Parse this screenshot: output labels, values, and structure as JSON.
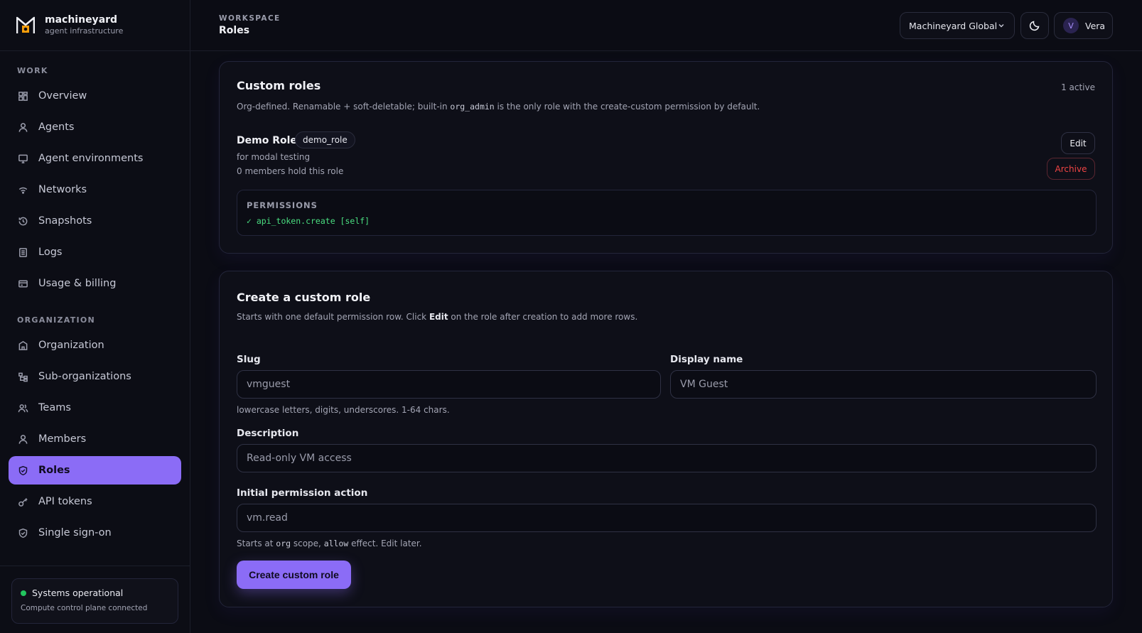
{
  "brand": {
    "name": "machineyard",
    "tagline": "agent infrastructure"
  },
  "sidebar": {
    "work_label": "WORK",
    "org_label": "ORGANIZATION",
    "work_items": [
      {
        "label": "Overview",
        "icon": "grid-icon"
      },
      {
        "label": "Agents",
        "icon": "user-icon"
      },
      {
        "label": "Agent environments",
        "icon": "monitor-icon"
      },
      {
        "label": "Networks",
        "icon": "wifi-icon"
      },
      {
        "label": "Snapshots",
        "icon": "history-icon"
      },
      {
        "label": "Logs",
        "icon": "document-icon"
      },
      {
        "label": "Usage & billing",
        "icon": "card-icon"
      }
    ],
    "org_items": [
      {
        "label": "Organization",
        "icon": "building-icon"
      },
      {
        "label": "Sub-organizations",
        "icon": "tree-icon"
      },
      {
        "label": "Teams",
        "icon": "users-icon"
      },
      {
        "label": "Members",
        "icon": "person-icon"
      },
      {
        "label": "Roles",
        "icon": "shield-icon",
        "active": true
      },
      {
        "label": "API tokens",
        "icon": "key-icon"
      },
      {
        "label": "Single sign-on",
        "icon": "shield-check-icon"
      }
    ],
    "status": {
      "title": "Systems operational",
      "subtitle": "Compute control plane connected",
      "color": "#22c55e"
    }
  },
  "header": {
    "section": "WORKSPACE",
    "title": "Roles",
    "org_select": "Machineyard Global",
    "user": {
      "initial": "V",
      "name": "Vera"
    }
  },
  "custom_roles": {
    "title": "Custom roles",
    "active_count": "1 active",
    "desc_before": "Org-defined. Renamable + soft-deletable; built-in ",
    "desc_code": "org_admin",
    "desc_after": " is the only role with the create-custom permission by default.",
    "role": {
      "name": "Demo Role",
      "slug": "demo_role",
      "description": "for modal testing",
      "members": "0 members hold this role",
      "edit_label": "Edit",
      "archive_label": "Archive",
      "permissions_label": "PERMISSIONS",
      "permissions": [
        "✓ api_token.create [self]"
      ]
    }
  },
  "create_role": {
    "title": "Create a custom role",
    "desc_before": "Starts with one default permission row. Click ",
    "desc_bold": "Edit",
    "desc_after": " on the role after creation to add more rows.",
    "slug_label": "Slug",
    "slug_placeholder": "vmguest",
    "slug_hint": "lowercase letters, digits, underscores. 1-64 chars.",
    "display_label": "Display name",
    "display_placeholder": "VM Guest",
    "description_label": "Description",
    "description_placeholder": "Read-only VM access",
    "action_label": "Initial permission action",
    "action_placeholder": "vm.read",
    "hint_1": "Starts at ",
    "hint_code1": "org",
    "hint_2": " scope, ",
    "hint_code2": "allow",
    "hint_3": " effect. Edit later.",
    "submit_label": "Create custom role"
  },
  "colors": {
    "accent": "#8b6cf6",
    "danger": "#ef4444",
    "success": "#4ade80"
  }
}
